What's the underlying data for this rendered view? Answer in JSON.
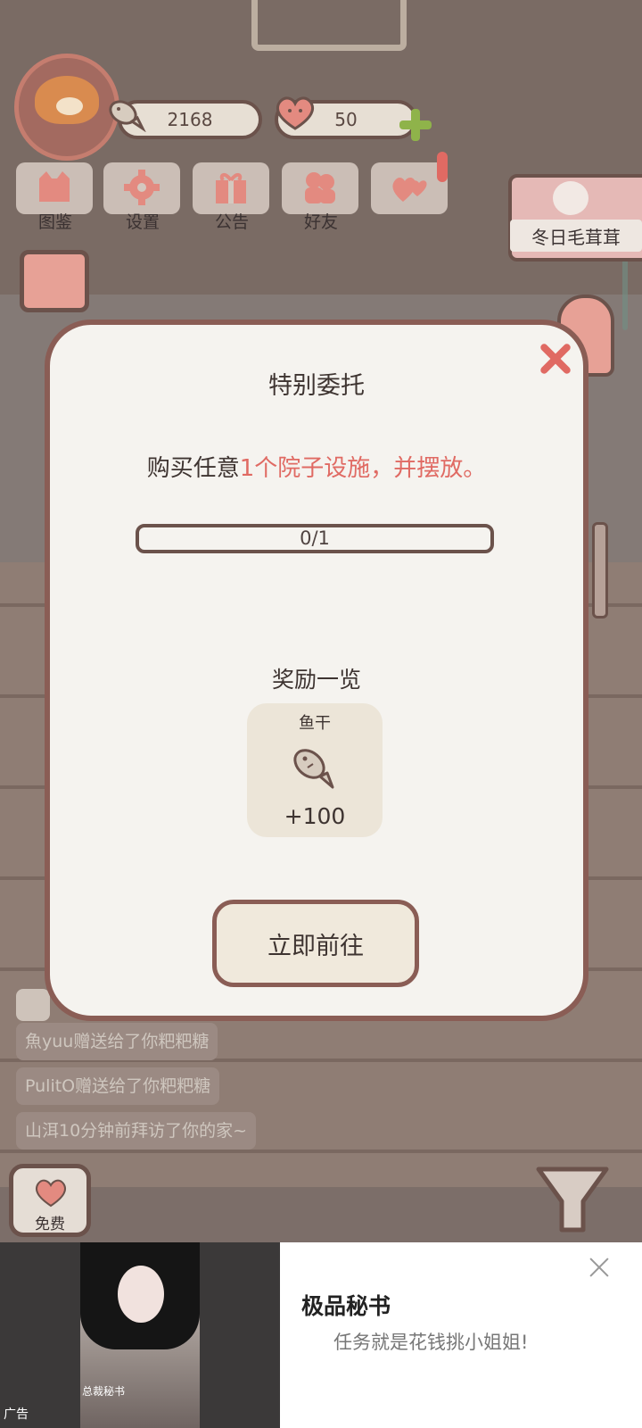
{
  "hud": {
    "fish_count": "2168",
    "heart_count": "50"
  },
  "menu": {
    "items": [
      {
        "label": "图鉴",
        "icon": "cat-head-icon"
      },
      {
        "label": "设置",
        "icon": "gear-icon"
      },
      {
        "label": "公告",
        "icon": "gift-icon"
      },
      {
        "label": "好友",
        "icon": "friends-icon"
      },
      {
        "label": "",
        "icon": "hearts-icon"
      }
    ]
  },
  "event_banner": {
    "label": "冬日毛茸茸"
  },
  "feed": [
    "魚yuu赠送给了你粑粑糖",
    "PulitO赠送给了你粑粑糖",
    "山洱10分钟前拜访了你的家~"
  ],
  "free_button": {
    "label": "免费"
  },
  "modal": {
    "title": "特别委托",
    "task_prefix": "购买任意",
    "task_highlight": "1个院子设施，并摆放。",
    "progress_text": "0/1",
    "progress_fraction": 0,
    "rewards_title": "奖励一览",
    "reward": {
      "name": "鱼干",
      "amount": "+100",
      "icon": "fish-icon"
    },
    "go_button": "立即前往"
  },
  "ad": {
    "title": "极品秘书",
    "subtitle": "任务就是花钱挑小姐姐!",
    "label": "广告",
    "caption": "总裁秘书"
  },
  "colors": {
    "accent_red": "#e06a63",
    "border_brown": "#8a5d55",
    "plus_green": "#8fb34a"
  }
}
